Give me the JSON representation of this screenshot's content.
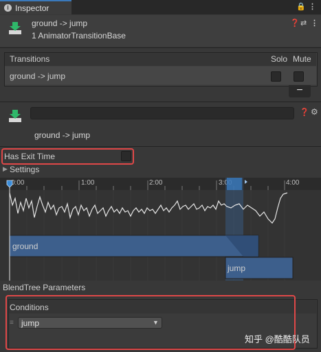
{
  "tab": {
    "label": "Inspector",
    "lock_icon": "lock-icon",
    "menu_icon": "kebab-menu-icon"
  },
  "header": {
    "title": "ground -> jump",
    "subtitle": "1 AnimatorTransitionBase"
  },
  "transitions": {
    "header": "Transitions",
    "solo_label": "Solo",
    "mute_label": "Mute",
    "rows": [
      {
        "name": "ground -> jump",
        "solo": false,
        "mute": false
      }
    ],
    "remove_label": "−"
  },
  "transition_settings": {
    "name_value": "",
    "label": "ground -> jump",
    "has_exit_time_label": "Has Exit Time",
    "has_exit_time": false,
    "settings_label": "Settings"
  },
  "timeline": {
    "ticks": [
      "0:00",
      "1:00",
      "2:00",
      "3:00",
      "4:00"
    ],
    "source_state": "ground",
    "dest_state": "jump"
  },
  "blendtree": {
    "label": "BlendTree Parameters"
  },
  "conditions": {
    "header": "Conditions",
    "parameter": "jump"
  },
  "watermark": "知乎 @酷酷队员",
  "colors": {
    "accent": "#3a79bb",
    "highlight_border": "#e04848",
    "state_bar": "#3d5f8c"
  }
}
